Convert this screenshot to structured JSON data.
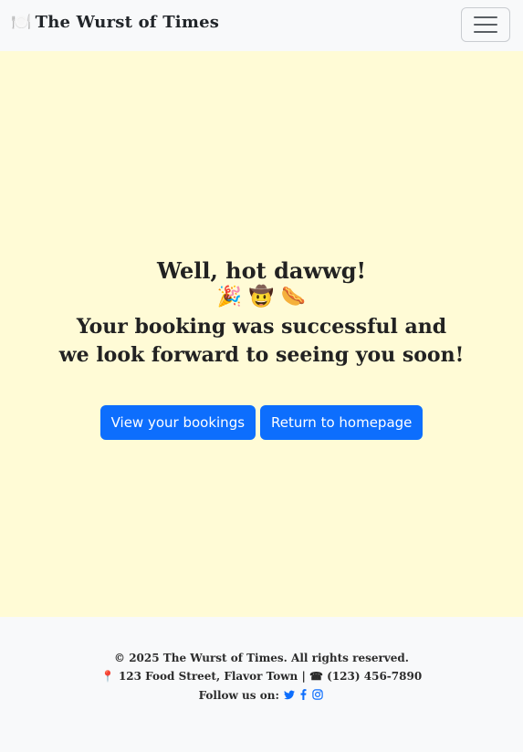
{
  "navbar": {
    "brand_icon": "🍽️",
    "brand_text": "The Wurst of Times",
    "toggle_icon": "hamburger-menu-icon"
  },
  "main": {
    "title": "Well, hot dawwg!",
    "emojis": "🎉 🤠 🌭",
    "line1": "Your booking was successful and",
    "line2": "we look forward to seeing you soon!",
    "buttons": {
      "view_bookings": "View your bookings",
      "return_home": "Return to homepage"
    }
  },
  "footer": {
    "copyright": "© 2025 The Wurst of Times. All rights reserved.",
    "address_icon": "📍",
    "address": "123 Food Street, Flavor Town",
    "separator": "|",
    "phone_icon": "☎",
    "phone": "(123) 456-7890",
    "follow_label": "Follow us on:",
    "social": [
      "twitter-icon",
      "facebook-icon",
      "instagram-icon"
    ]
  },
  "colors": {
    "background": "#fffbd6",
    "primary": "#0d6efd",
    "navbar": "#f8f9fa"
  }
}
